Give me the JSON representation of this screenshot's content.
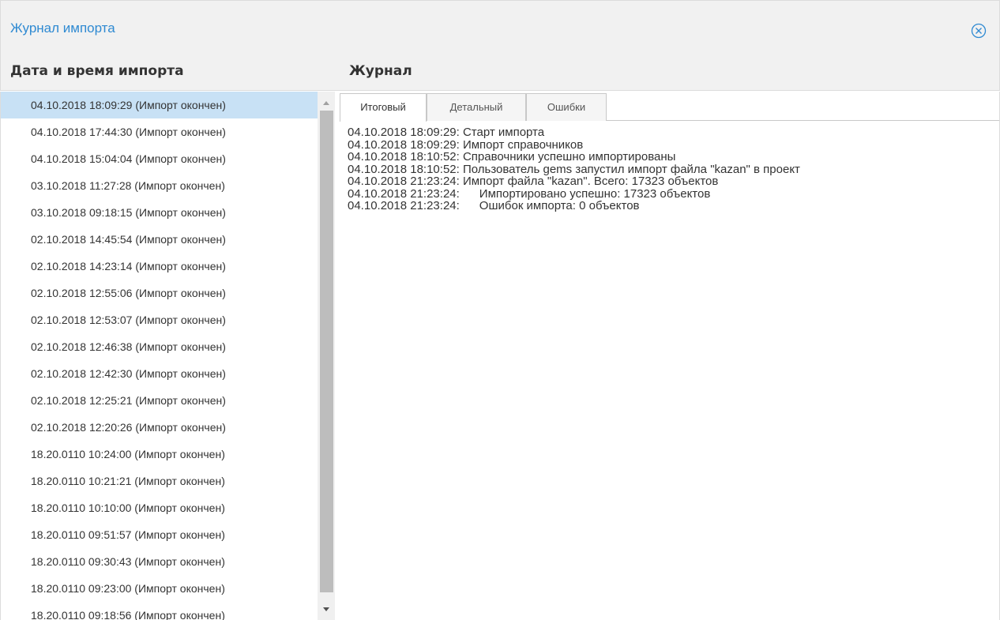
{
  "dialog": {
    "title": "Журнал импорта",
    "close_icon": "close-circle-icon"
  },
  "headers": {
    "left": "Дата и время импорта",
    "right": "Журнал"
  },
  "imports": [
    "04.10.2018 18:09:29 (Импорт окончен)",
    "04.10.2018 17:44:30 (Импорт окончен)",
    "04.10.2018 15:04:04 (Импорт окончен)",
    "03.10.2018 11:27:28 (Импорт окончен)",
    "03.10.2018 09:18:15 (Импорт окончен)",
    "02.10.2018 14:45:54 (Импорт окончен)",
    "02.10.2018 14:23:14 (Импорт окончен)",
    "02.10.2018 12:55:06 (Импорт окончен)",
    "02.10.2018 12:53:07 (Импорт окончен)",
    "02.10.2018 12:46:38 (Импорт окончен)",
    "02.10.2018 12:42:30 (Импорт окончен)",
    "02.10.2018 12:25:21 (Импорт окончен)",
    "02.10.2018 12:20:26 (Импорт окончен)",
    "18.20.0110 10:24:00 (Импорт окончен)",
    "18.20.0110 10:21:21 (Импорт окончен)",
    "18.20.0110 10:10:00 (Импорт окончен)",
    "18.20.0110 09:51:57 (Импорт окончен)",
    "18.20.0110 09:30:43 (Импорт окончен)",
    "18.20.0110 09:23:00 (Импорт окончен)",
    "18.20.0110 09:18:56 (Импорт окончен)"
  ],
  "selected_index": 0,
  "tabs": [
    {
      "label": "Итоговый",
      "active": true
    },
    {
      "label": "Детальный",
      "active": false
    },
    {
      "label": "Ошибки",
      "active": false
    }
  ],
  "log_lines": [
    "04.10.2018 18:09:29: Старт импорта",
    "04.10.2018 18:09:29: Импорт справочников",
    "04.10.2018 18:10:52: Справочники успешно импортированы",
    "04.10.2018 18:10:52: Пользователь gems запустил импорт файла \"kazan\" в проект",
    "04.10.2018 21:23:24: Импорт файла \"kazan\". Всего: 17323 объектов",
    "04.10.2018 21:23:24:      Импортировано успешно: 17323 объектов",
    "04.10.2018 21:23:24:      Ошибок импорта: 0 объектов"
  ],
  "colors": {
    "accent": "#2f8ad2",
    "selected_row": "#c8e1f5",
    "header_bg": "#f1f1f1"
  }
}
